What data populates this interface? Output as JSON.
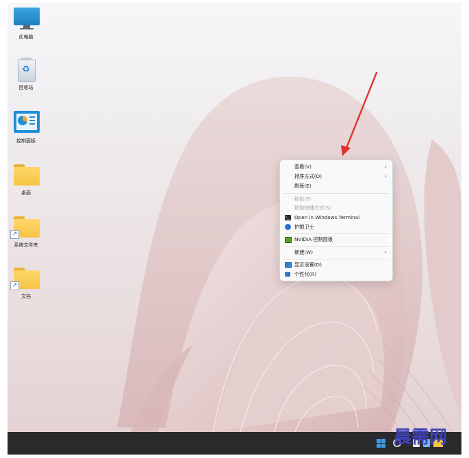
{
  "desktop": {
    "icons": [
      {
        "label": "此电脑",
        "icon": "monitor-icon"
      },
      {
        "label": "回收站",
        "icon": "recycle-bin-icon"
      },
      {
        "label": "控制面板",
        "icon": "control-panel-icon"
      },
      {
        "label": "桌面",
        "icon": "folder-icon"
      },
      {
        "label": "系统文件夹",
        "icon": "folder-shortcut-icon"
      },
      {
        "label": "文档",
        "icon": "folder-shortcut-icon"
      }
    ]
  },
  "context_menu": {
    "items": [
      {
        "label": "查看(V)",
        "submenu": true,
        "enabled": true
      },
      {
        "label": "排序方式(O)",
        "submenu": true,
        "enabled": true
      },
      {
        "label": "刷新(E)",
        "submenu": false,
        "enabled": true
      },
      {
        "label": "粘贴(P)",
        "submenu": false,
        "enabled": false
      },
      {
        "label": "粘贴快捷方式(S)",
        "submenu": false,
        "enabled": false
      },
      {
        "label": "Open in Windows Terminal",
        "icon": "terminal-icon",
        "enabled": true
      },
      {
        "label": "护眼卫士",
        "icon": "eye-guard-icon",
        "enabled": true
      },
      {
        "label": "NVIDIA 控制面板",
        "icon": "nvidia-icon",
        "enabled": true
      },
      {
        "label": "新建(W)",
        "submenu": true,
        "enabled": true
      },
      {
        "label": "显示设置(D)",
        "icon": "display-settings-icon",
        "enabled": true
      },
      {
        "label": "个性化(R)",
        "icon": "personalize-icon",
        "enabled": true
      }
    ]
  },
  "taskbar": {
    "start_icon": "windows-logo-icon"
  },
  "watermark": {
    "text": "晨需网"
  },
  "colors": {
    "taskbar": "#2a2a2c",
    "annotation_arrow": "#e0312b",
    "watermark": "#3f43b8",
    "start_accent": "#3d9be9"
  }
}
